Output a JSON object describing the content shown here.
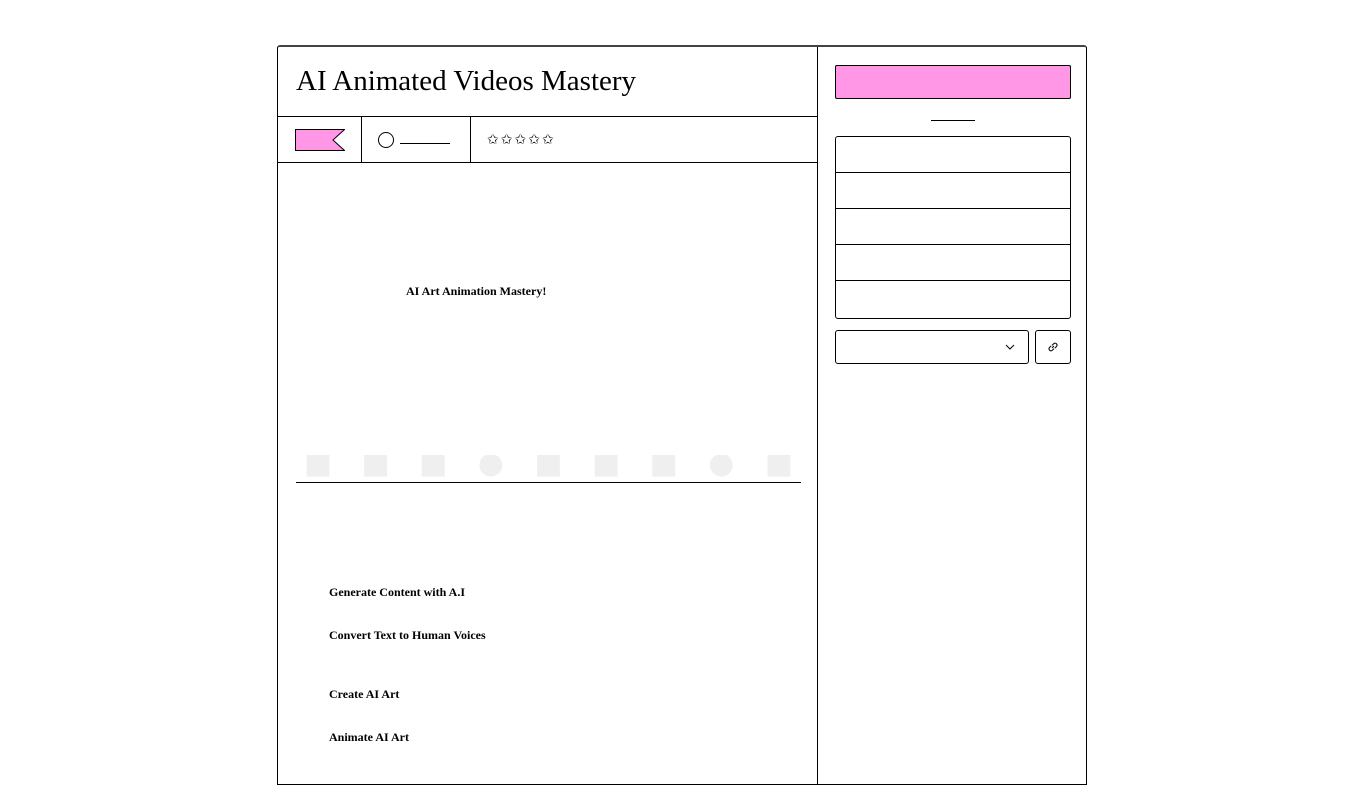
{
  "product": {
    "title": "AI Animated Videos Mastery",
    "rating_stars": 5,
    "hero_text": "AI Art Animation Mastery!",
    "features": [
      "Generate Content with A.I",
      "Convert Text to Human Voices",
      "Create AI Art",
      "Animate AI Art"
    ],
    "strip_icons": [
      "megaphone-icon",
      "video-icon",
      "laptop-icon",
      "chat-icon",
      "book-icon",
      "document-icon",
      "edit-icon",
      "camera-icon",
      "gift-icon"
    ]
  },
  "sidebar": {
    "cta_label": "",
    "select_value": "",
    "info_items": [
      "",
      "",
      "",
      "",
      ""
    ]
  },
  "colors": {
    "accent": "#ff96e6",
    "border": "#000000"
  }
}
